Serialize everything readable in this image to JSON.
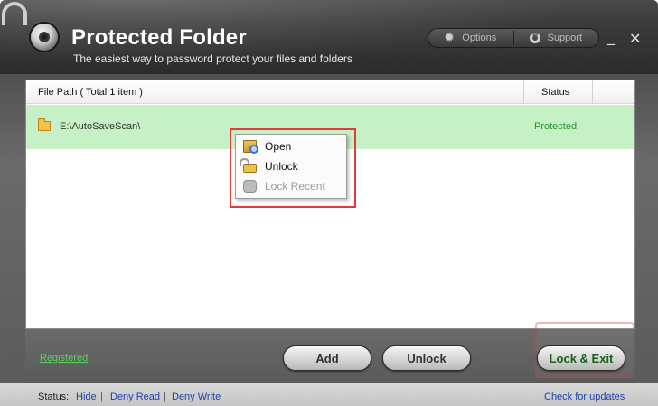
{
  "app": {
    "title": "Protected Folder",
    "subtitle": "The easiest way to password protect your files and folders"
  },
  "header_menu": {
    "options_label": "Options",
    "support_label": "Support",
    "minimize_glyph": "_",
    "close_glyph": "✕"
  },
  "list": {
    "columns": {
      "path": "File Path  ( Total 1 item )",
      "status": "Status"
    },
    "rows": [
      {
        "path": "E:\\AutoSaveScan\\",
        "status": "Protected"
      }
    ],
    "row_colors": {
      "selected_bg": "#c6f0c6",
      "status_text": "#1f9a2c"
    }
  },
  "context_menu": {
    "items": [
      {
        "label": "Open",
        "icon": "open-folder-icon",
        "enabled": true
      },
      {
        "label": "Unlock",
        "icon": "unlock-icon",
        "enabled": true
      },
      {
        "label": "Lock Recent",
        "icon": "lock-recent-icon",
        "enabled": false
      }
    ],
    "highlight_color": "#e23b3b"
  },
  "bottom": {
    "registered_label": "Registered",
    "add_label": "Add",
    "unlock_label": "Unlock",
    "lock_exit_label": "Lock & Exit"
  },
  "status_bar": {
    "label": "Status:",
    "links": [
      "Hide",
      "Deny Read",
      "Deny Write"
    ],
    "separator": "|",
    "check_updates": "Check for updates"
  }
}
